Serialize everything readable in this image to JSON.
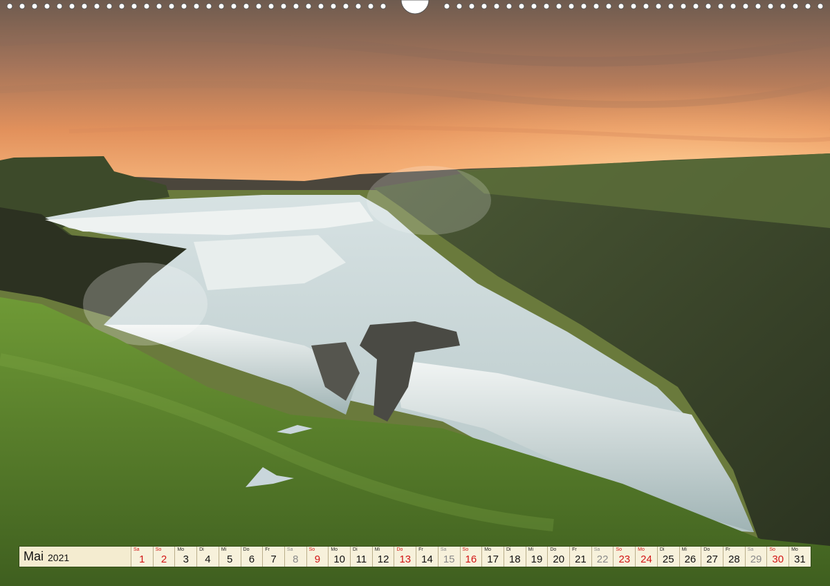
{
  "calendar": {
    "month": "Mai",
    "year": "2021",
    "days": [
      {
        "wd": "Sa",
        "num": "1",
        "type": "hol"
      },
      {
        "wd": "So",
        "num": "2",
        "type": "sun"
      },
      {
        "wd": "Mo",
        "num": "3",
        "type": "work"
      },
      {
        "wd": "Di",
        "num": "4",
        "type": "work"
      },
      {
        "wd": "Mi",
        "num": "5",
        "type": "work"
      },
      {
        "wd": "Do",
        "num": "6",
        "type": "work"
      },
      {
        "wd": "Fr",
        "num": "7",
        "type": "work"
      },
      {
        "wd": "Sa",
        "num": "8",
        "type": "sat"
      },
      {
        "wd": "So",
        "num": "9",
        "type": "sun"
      },
      {
        "wd": "Mo",
        "num": "10",
        "type": "work"
      },
      {
        "wd": "Di",
        "num": "11",
        "type": "work"
      },
      {
        "wd": "Mi",
        "num": "12",
        "type": "work"
      },
      {
        "wd": "Do",
        "num": "13",
        "type": "hol"
      },
      {
        "wd": "Fr",
        "num": "14",
        "type": "work"
      },
      {
        "wd": "Sa",
        "num": "15",
        "type": "sat"
      },
      {
        "wd": "So",
        "num": "16",
        "type": "sun"
      },
      {
        "wd": "Mo",
        "num": "17",
        "type": "work"
      },
      {
        "wd": "Di",
        "num": "18",
        "type": "work"
      },
      {
        "wd": "Mi",
        "num": "19",
        "type": "work"
      },
      {
        "wd": "Do",
        "num": "20",
        "type": "work"
      },
      {
        "wd": "Fr",
        "num": "21",
        "type": "work"
      },
      {
        "wd": "Sa",
        "num": "22",
        "type": "sat"
      },
      {
        "wd": "So",
        "num": "23",
        "type": "sun"
      },
      {
        "wd": "Mo",
        "num": "24",
        "type": "hol"
      },
      {
        "wd": "Di",
        "num": "25",
        "type": "work"
      },
      {
        "wd": "Mi",
        "num": "26",
        "type": "work"
      },
      {
        "wd": "Do",
        "num": "27",
        "type": "work"
      },
      {
        "wd": "Fr",
        "num": "28",
        "type": "work"
      },
      {
        "wd": "Sa",
        "num": "29",
        "type": "sat"
      },
      {
        "wd": "So",
        "num": "30",
        "type": "sun"
      },
      {
        "wd": "Mo",
        "num": "31",
        "type": "work"
      }
    ]
  },
  "colors": {
    "sunday_red": "#d21515",
    "saturday_grey": "#8a8a8a",
    "strip_background": "#f7f1db"
  }
}
